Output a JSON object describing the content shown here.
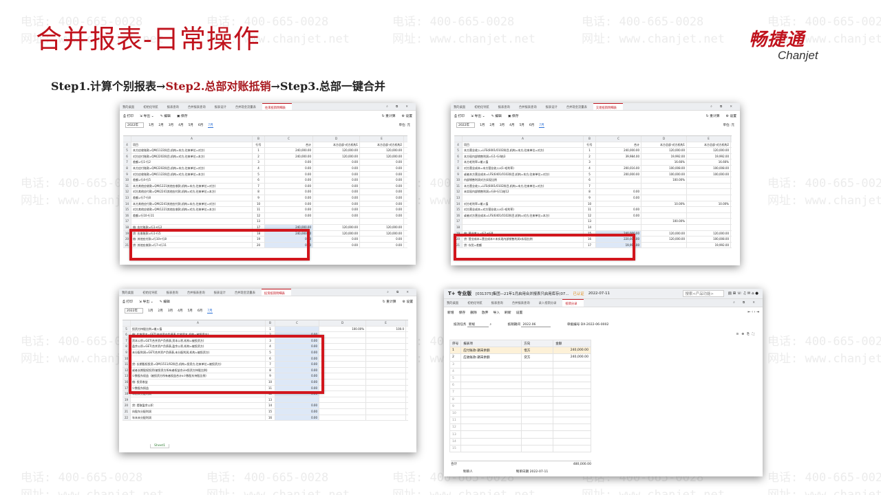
{
  "watermark": {
    "phone": "电话: 400-665-0028",
    "site": "网址: www.chanjet.net"
  },
  "title": "合并报表-日常操作",
  "logo": {
    "cn": "畅捷通",
    "en": "Chanjet"
  },
  "steps": {
    "s1": "Step1.计算个别报表→",
    "s2": "Step2.总部对账抵销",
    "s3": "→Step3.总部一键合并"
  },
  "colors": {
    "accent": "#c0121c",
    "highlight_box": "#d2161d"
  },
  "sheet_common": {
    "tabs": [
      "我的桌面",
      "初始化导航",
      "报表查询",
      "合并报表查询",
      "报表设计",
      "合并现金流量表"
    ],
    "toolbar": {
      "print": "打印",
      "export": "导出",
      "edit": "编辑",
      "save": "保存",
      "recalc": "重计算",
      "settings": "设置"
    },
    "year": "2022年",
    "months": [
      "1月",
      "2月",
      "3月",
      "4月",
      "5月",
      "6月",
      "7月"
    ],
    "unit": "单位: 元",
    "cols": [
      "A",
      "B",
      "C",
      "D",
      "E"
    ]
  },
  "shot1": {
    "active_tab": "往来抵销明细表",
    "header": [
      "项目",
      "行号",
      "合计",
      "本方总部-对方机构1",
      "本方总部-对方机构2",
      "本方"
    ],
    "rows": [
      [
        "4",
        "项目",
        "行号",
        "合计",
        "本方总部-对方机构1",
        "本方总部-对方机构2"
      ],
      [
        "5",
        "本方应收账款=QM(1122科目,机构=本方,往来单位=对方)",
        "1",
        "240,000.00",
        "120,000.00",
        "120,000.00"
      ],
      [
        "6",
        "对方应付账款=QM(2202科目,机构=对方,往来单位=本方)",
        "2",
        "240,000.00",
        "120,000.00",
        "120,000.00"
      ],
      [
        "7",
        "差额=行1-行2",
        "3",
        "0.00",
        "0.00",
        "0.00"
      ],
      [
        "8",
        "本方应付账款=QM(2202科目,机构=本方,往来单位=对方)",
        "4",
        "0.00",
        "0.00",
        "0.00"
      ],
      [
        "9",
        "对方应收账款=QM(1122科目,机构=对方,往来单位=本方)",
        "5",
        "0.00",
        "0.00",
        "0.00"
      ],
      [
        "10",
        "差额=行4-行5",
        "6",
        "0.00",
        "0.00",
        "0.00"
      ],
      [
        "11",
        "本方其他应收款=QM(1221其他应收款,机构=本方,往来单位=对方)",
        "7",
        "0.00",
        "0.00",
        "0.00"
      ],
      [
        "12",
        "对方其他应付款=QM(2241其他应付款,机构=对方,往来单位=本方)",
        "8",
        "0.00",
        "0.00",
        "0.00"
      ],
      [
        "13",
        "差额=行7-行8",
        "9",
        "0.00",
        "0.00",
        "0.00"
      ],
      [
        "14",
        "本方其他应付款=QM(2241其他应付款,机构=本方,往来单位=对方)",
        "10",
        "0.00",
        "0.00",
        "0.00"
      ],
      [
        "15",
        "对方其他应收款=QM(1221其他应收款,机构=对方,往来单位=本方)",
        "11",
        "0.00",
        "0.00",
        "0.00"
      ],
      [
        "16",
        "差额=行10-行11",
        "12",
        "0.00",
        "0.00",
        "0.00"
      ],
      [
        "17",
        "",
        "13",
        "",
        "",
        ""
      ],
      [
        "18",
        "借: 应付账款=行1+行2",
        "17",
        "240,000.00",
        "120,000.00",
        "120,000.00"
      ],
      [
        "19",
        "  贷: 应收账款=行1-行5",
        "18",
        "240,000.00",
        "120,000.00",
        "120,000.00"
      ],
      [
        "20",
        "借: 其他应付款=行10+行8",
        "19",
        "0.00",
        "0.00",
        "0.00"
      ],
      [
        "21",
        "  贷: 其他应收款=行7+行11",
        "20",
        "0.00",
        "0.00",
        "0.00"
      ]
    ]
  },
  "shot2": {
    "active_tab": "交易抵销明细表",
    "rows": [
      [
        "4",
        "项目",
        "行号",
        "合计",
        "本方总部-对方机构1",
        "本方总部-对方机构2"
      ],
      [
        "5",
        "本方营业收入=LFS(6001/0102科目,机构=本方,往来单位=对方)",
        "1",
        "240,000.00",
        "120,000.00",
        "120,000.00"
      ],
      [
        "6",
        "本方现内部销售利润=行1-行4结3",
        "2",
        "39,984.00",
        "19,992.00",
        "19,992.00"
      ],
      [
        "7",
        "本方毛利率=输入值",
        "3",
        "",
        "16.66%",
        "16.66%"
      ],
      [
        "8",
        "对方营业成本=本方营业收入x(1-毛利率)",
        "4",
        "200,016.00",
        "100,008.00",
        "100,008.00"
      ],
      [
        "9",
        "或者本方营业成本=LFS(6401/0102科目,机构=本方,往来单位=对方)",
        "5",
        "200,000.00",
        "100,000.00",
        "100,000.00"
      ],
      [
        "10",
        "内部销售利润对方实现比例",
        "6",
        "",
        "100.00%",
        ""
      ],
      [
        "11",
        "本方营业收入=LFS(6001/0102科目,机构=本方,往来单位=对方)",
        "7",
        "",
        "",
        ""
      ],
      [
        "12",
        "未实现内部销售利润=行8-行11结12",
        "8",
        "0.00",
        "",
        ""
      ],
      [
        "13",
        "",
        "9",
        "0.00",
        "",
        ""
      ],
      [
        "14",
        "对方毛利率=输入值",
        "10",
        "",
        "10.00%",
        "10.00%"
      ],
      [
        "15",
        "对方营业成本=对方营业收入x(1-毛利率)",
        "11",
        "0.00",
        "",
        ""
      ],
      [
        "16",
        "或者对方营业成本=LFS(6401/0102科目,机构=对方,往来单位=本方)",
        "12",
        "0.00",
        "",
        ""
      ],
      [
        "17",
        "",
        "13",
        "",
        "100.00%",
        ""
      ],
      [
        "18",
        "",
        "14",
        "",
        "",
        ""
      ],
      [
        "19",
        "借: 营业收入=行1+行8",
        "15",
        "240,000.00",
        "120,000.00",
        "120,000.00"
      ],
      [
        "20",
        "  贷: 营业成本=营业成本+未实现内部销售利润x实现比例",
        "16",
        "220,008.00",
        "120,000.00",
        "100,008.00"
      ],
      [
        "21",
        "  贷: 存货=差额",
        "17",
        "19,992.00",
        "",
        "19,992.00"
      ]
    ]
  },
  "shot3": {
    "active_tab": "投资抵销明细表",
    "sheet_tab": "Sheet1",
    "rows": [
      [
        "5",
        "投资方持股比例=输入值",
        "1",
        "",
        "100.00%",
        "100.0"
      ],
      [
        "6",
        "借: 实收资本=GET(合并资产负债表,实收资本,机构=被投资方)",
        "2",
        "0.00",
        "",
        ""
      ],
      [
        "7",
        "  资本公积=GET(合并资产负债表,资本公积,机构=被投资方)",
        "3",
        "0.00",
        "",
        ""
      ],
      [
        "8",
        "  盈余公积=GET(合并资产负债表,盈余公积,机构=被投资方)",
        "4",
        "0.00",
        "",
        ""
      ],
      [
        "9",
        "  未分配利润=GET(合并资产负债表,未分配利润,机构=被投资方)",
        "5",
        "0.00",
        "",
        ""
      ],
      [
        "10",
        "",
        "6",
        "0.00",
        "",
        ""
      ],
      [
        "11",
        "  贷: 长期股权投资=QM(1511/02科目,机构=投资方,往来单位=被投资方)",
        "7",
        "0.00",
        "",
        ""
      ],
      [
        "12",
        "    或者长期股权投资(被投资方所有者权益合计x投资方持股比例)",
        "8",
        "0.00",
        "",
        ""
      ],
      [
        "13",
        "    少数股东权益（被投资方所有者权益合计x少数股东持股比例）",
        "9",
        "0.00",
        "",
        ""
      ],
      [
        "16",
        "借: 投资收益",
        "10",
        "0.00",
        "",
        ""
      ],
      [
        "17",
        "  少数股东损益",
        "11",
        "0.00",
        "",
        ""
      ],
      [
        "18",
        "  年初未分配利润",
        "12",
        "0.00",
        "",
        ""
      ],
      [
        "19",
        "",
        "13",
        "",
        "",
        ""
      ],
      [
        "20",
        "  贷: 提取盈余公积",
        "14",
        "0.00",
        "",
        ""
      ],
      [
        "21",
        "    向股东分配利润",
        "15",
        "0.00",
        "",
        ""
      ],
      [
        "22",
        "    年末未分配利润",
        "16",
        "0.00",
        "",
        ""
      ]
    ]
  },
  "shot4": {
    "brand": "T+ 专业版",
    "company": "[031375]集团—21年1月启用合并报表只启用库存(07...",
    "warn": "已认证",
    "date": "2022-07-11",
    "search": "搜索<产品功能>",
    "tabs": [
      "我的桌面",
      "初始化导航",
      "报表查询",
      "合并报表查询",
      "录入抵销分录",
      "抵销分录"
    ],
    "toolbar": [
      "新增",
      "保存",
      "删除",
      "放弃",
      "导入",
      "刷新",
      "设置"
    ],
    "filter": {
      "task_label": "抵消任务",
      "task_value": "新规",
      "period_label": "抵销期间",
      "period_value": "2022.06",
      "doc_label": "单据编号",
      "doc_value": "DX-2022-06-0002"
    },
    "table_head": [
      "序号",
      "报表项",
      "方向",
      "金额"
    ],
    "table_rows": [
      [
        "1",
        "应付账款-期末余额",
        "借方",
        "240,000.00"
      ],
      [
        "2",
        "应收账款-期末余额",
        "贷方",
        "240,000.00"
      ]
    ],
    "total_label": "合计",
    "total_value": "480,000.00",
    "maker_label": "制单人",
    "maker_value": "",
    "date_label": "制单日期",
    "date_value": "2022-07-11"
  }
}
